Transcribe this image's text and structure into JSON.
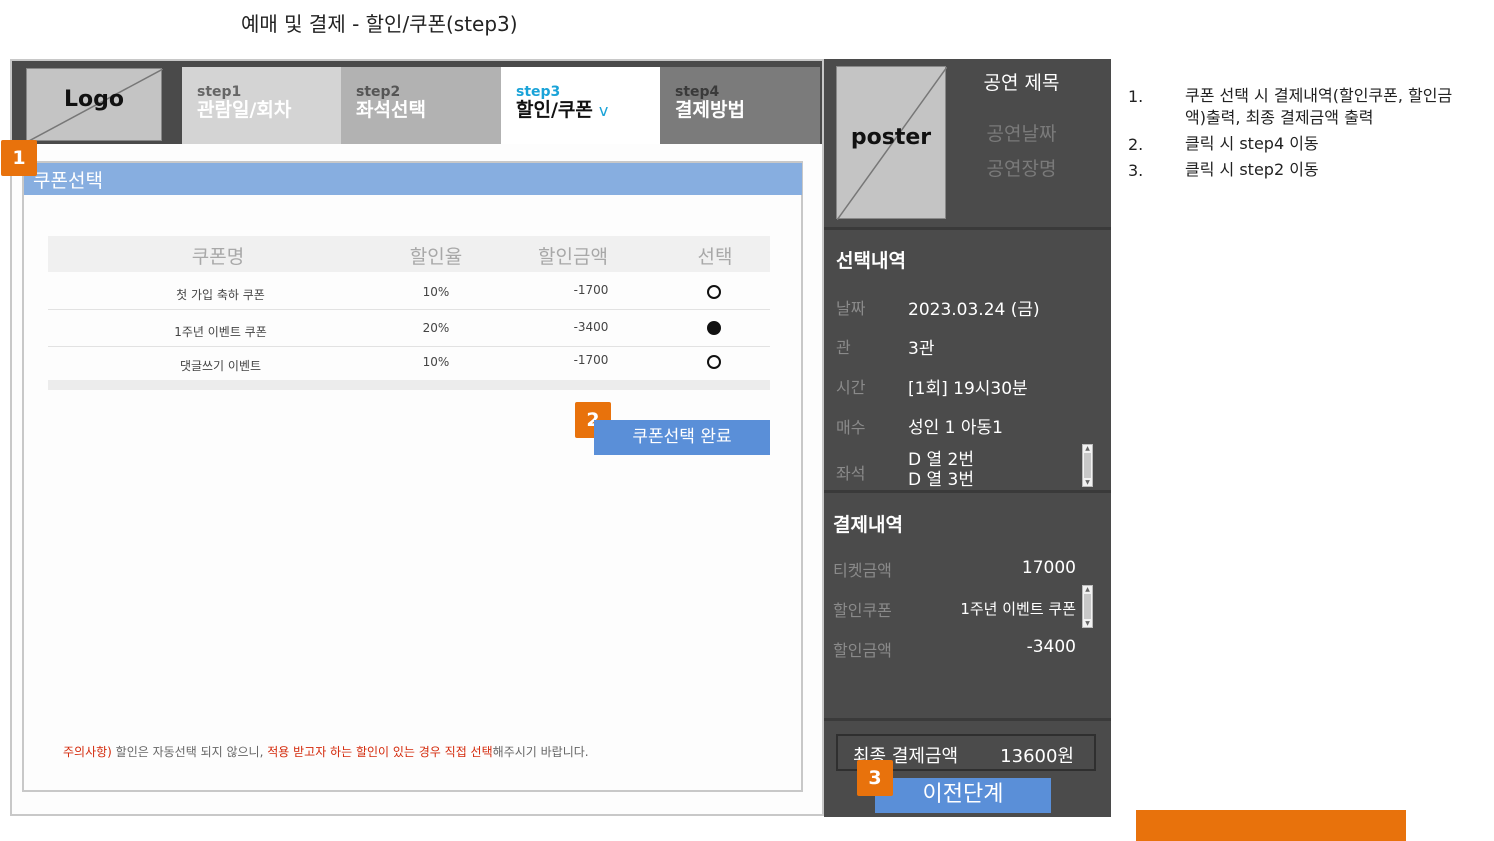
{
  "page_title": "예매 및 결제 - 할인/쿠폰(step3)",
  "logo": {
    "label": "Logo"
  },
  "steps": [
    {
      "no": "step1",
      "name": "관람일/회차"
    },
    {
      "no": "step2",
      "name": "좌석선택"
    },
    {
      "no": "step3",
      "name": "할인/쿠폰",
      "chevron": "v"
    },
    {
      "no": "step4",
      "name": "결제방법"
    }
  ],
  "badges": {
    "one": "1",
    "two": "2",
    "three": "3"
  },
  "coupon": {
    "header": "쿠폰선택",
    "columns": [
      "쿠폰명",
      "할인율",
      "할인금액",
      "선택"
    ],
    "rows": [
      {
        "name": "첫 가입 축하 쿠폰",
        "rate": "10%",
        "amount": "-1700",
        "selected": false
      },
      {
        "name": "1주년 이벤트 쿠폰",
        "rate": "20%",
        "amount": "-3400",
        "selected": true
      },
      {
        "name": "댓글쓰기 이벤트",
        "rate": "10%",
        "amount": "-1700",
        "selected": false
      }
    ],
    "complete_button": "쿠폰선택 완료",
    "notice_prefix": "주의사항)",
    "notice_mid": " 할인은 자동선택 되지 않으니, ",
    "notice_red": "적용 받고자 하는 할인이 있는 경우 직접 선택",
    "notice_suffix": "해주시기 바랍니다."
  },
  "show": {
    "poster_label": "poster",
    "title": "공연 제목",
    "date_placeholder": "공연날짜",
    "venue_placeholder": "공연장명"
  },
  "selection": {
    "title": "선택내역",
    "date_label": "날짜",
    "date_value": "2023.03.24 (금)",
    "hall_label": "관",
    "hall_value": "3관",
    "time_label": "시간",
    "time_value": "[1회] 19시30분",
    "count_label": "매수",
    "count_value": "성인 1 아동1",
    "seat_label": "좌석",
    "seat_1": "D 열 2번",
    "seat_2": "D 열 3번"
  },
  "payment": {
    "title": "결제내역",
    "ticket_label": "티켓금액",
    "ticket_value": "17000",
    "coupon_label": "할인쿠폰",
    "coupon_value": "1주년 이벤트 쿠폰",
    "discount_label": "할인금액",
    "discount_value": "-3400",
    "final_label": "최종 결제금액",
    "final_value": "13600원"
  },
  "prev_button": "이전단계",
  "notes": [
    {
      "num": "1.",
      "line1": "쿠폰 선택 시 결제내역(할인쿠폰, 할인금",
      "line2": "액)출력, 최종 결제금액 출력"
    },
    {
      "num": "2.",
      "line1": "클릭 시 step4 이동"
    },
    {
      "num": "3.",
      "line1": "클릭 시 step2 이동"
    }
  ],
  "colors": {
    "accent_orange": "#e8720c",
    "button_blue": "#5a8fd8",
    "header_blue": "#87aee0",
    "sidebar": "#4b4b4b",
    "step3_blue": "#1aa3d8",
    "notice_red": "#d42a0c"
  }
}
